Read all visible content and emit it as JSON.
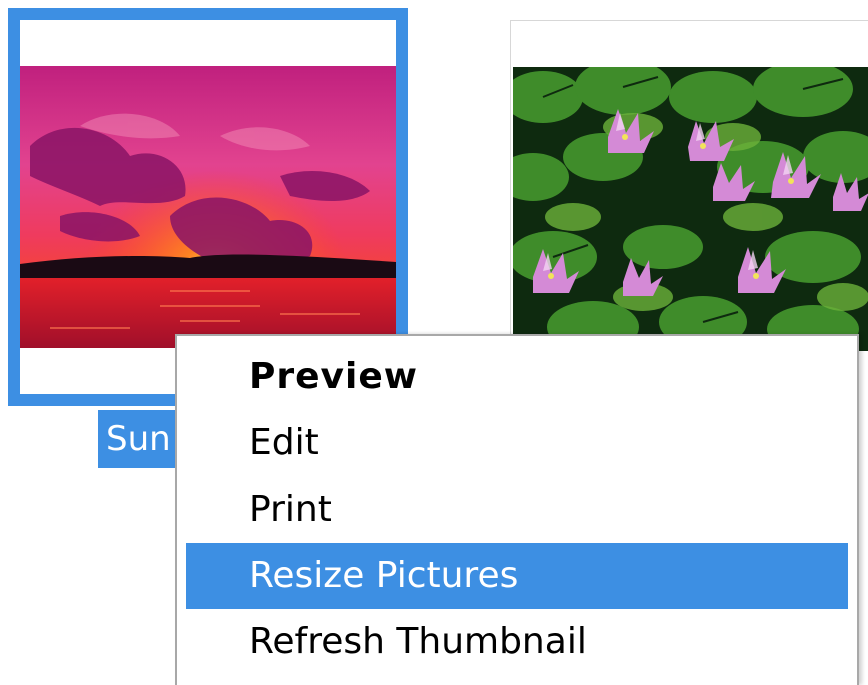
{
  "thumbnails": [
    {
      "caption": "Sunset",
      "caption_visible": "Sun",
      "selected": true,
      "image_description": "sunset-photo"
    },
    {
      "caption": "",
      "selected": false,
      "image_description": "water-lilies-photo"
    }
  ],
  "context_menu": {
    "items": [
      {
        "label": "Preview",
        "default": true,
        "highlighted": false
      },
      {
        "label": "Edit",
        "default": false,
        "highlighted": false
      },
      {
        "label": "Print",
        "default": false,
        "highlighted": false
      },
      {
        "label": "Resize Pictures",
        "default": false,
        "highlighted": true
      },
      {
        "label": "Refresh Thumbnail",
        "default": false,
        "highlighted": false
      }
    ]
  },
  "colors": {
    "selection": "#3d8fe3",
    "menu_border": "#a8a8a8",
    "background": "#ffffff"
  }
}
